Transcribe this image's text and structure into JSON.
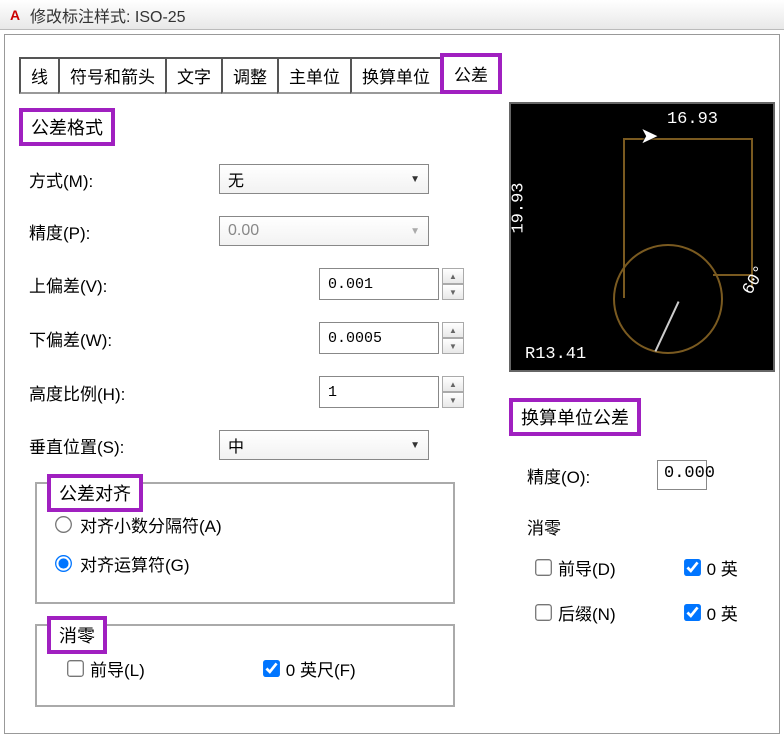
{
  "window": {
    "title": "修改标注样式: ISO-25",
    "app_icon": "A"
  },
  "tabs": {
    "items": [
      {
        "label": "线"
      },
      {
        "label": "符号和箭头"
      },
      {
        "label": "文字"
      },
      {
        "label": "调整"
      },
      {
        "label": "主单位"
      },
      {
        "label": "换算单位"
      },
      {
        "label": "公差"
      }
    ],
    "active_index": 6
  },
  "cursor": "➤",
  "left": {
    "section_format": "公差格式",
    "method_label": "方式(M):",
    "method_value": "无",
    "precision_label": "精度(P):",
    "precision_value": "0.00",
    "upper_label": "上偏差(V):",
    "upper_value": "0.001",
    "lower_label": "下偏差(W):",
    "lower_value": "0.0005",
    "height_label": "高度比例(H):",
    "height_value": "1",
    "vpos_label": "垂直位置(S):",
    "vpos_value": "中",
    "section_align": "公差对齐",
    "align_decimal": "对齐小数分隔符(A)",
    "align_operator": "对齐运算符(G)",
    "section_zero": "消零",
    "leading_label": "前导(L)",
    "feet_label": "0 英尺(F)"
  },
  "preview": {
    "dim_top": "16.93",
    "dim_left": "19.93",
    "dim_radius": "R13.41",
    "dim_angle": "60°"
  },
  "right": {
    "section_alt": "换算单位公差",
    "precision_label": "精度(O):",
    "precision_value": "0.000",
    "zero_label": "消零",
    "leading_d": "前导(D)",
    "trailing_n": "后缀(N)",
    "zero_ft": "0 英",
    "zero_in": "0 英"
  }
}
